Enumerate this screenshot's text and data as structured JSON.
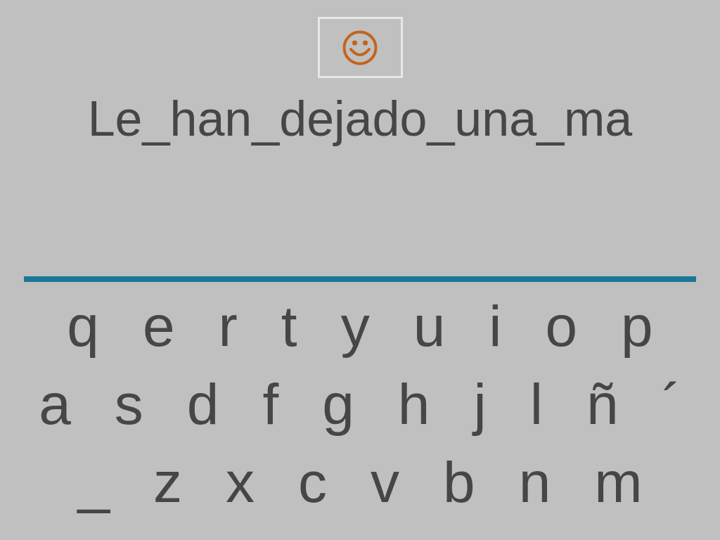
{
  "phrase": "Le_han_dejado_una_ma",
  "keyboard_rows": [
    [
      "q",
      "e",
      "r",
      "t",
      "y",
      "u",
      "i",
      "o",
      "p"
    ],
    [
      "a",
      "s",
      "d",
      "f",
      "g",
      "h",
      "j",
      "l",
      "ñ",
      "´"
    ],
    [
      "_",
      "z",
      "x",
      "c",
      "v",
      "b",
      "n",
      "m"
    ]
  ]
}
